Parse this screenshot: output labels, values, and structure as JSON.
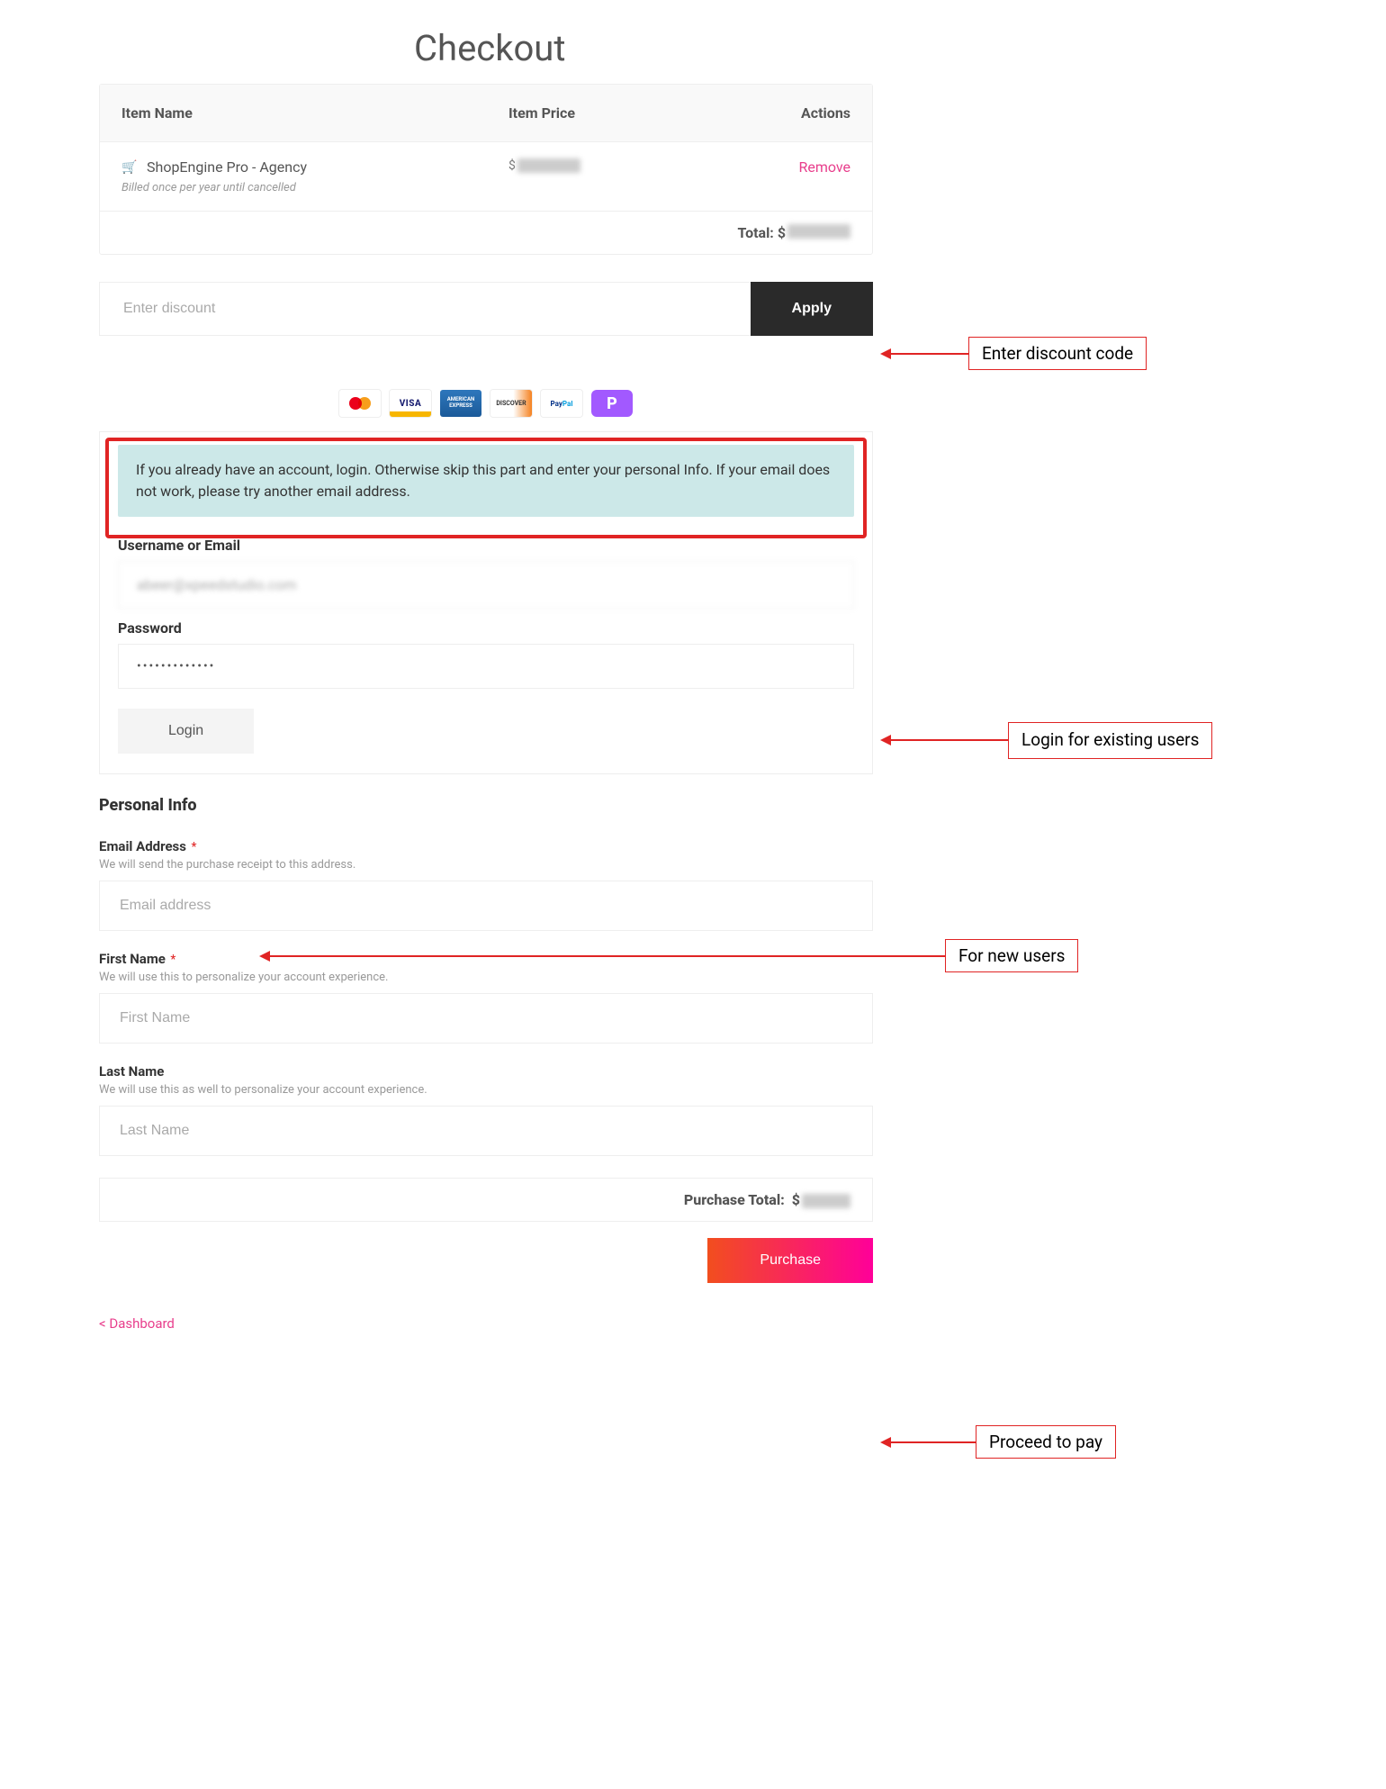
{
  "page": {
    "title": "Checkout"
  },
  "table": {
    "headers": {
      "name": "Item Name",
      "price": "Item Price",
      "actions": "Actions"
    },
    "item": {
      "name": "ShopEngine Pro - Agency",
      "subtitle": "Billed once per year until cancelled",
      "currency": "$",
      "remove": "Remove"
    },
    "total_label": "Total:",
    "total_currency": "$"
  },
  "discount": {
    "placeholder": "Enter discount",
    "apply_label": "Apply"
  },
  "login": {
    "info": "If you already have an account, login. Otherwise skip this part and enter your personal Info. If your email does not work, please try another email address.",
    "username_label": "Username or Email",
    "username_value": "abeer@xpeedstudio.com",
    "password_label": "Password",
    "password_value": "•••••••••••••",
    "login_label": "Login"
  },
  "personal": {
    "section_title": "Personal Info",
    "email": {
      "label": "Email Address",
      "required": "*",
      "help": "We will send the purchase receipt to this address.",
      "placeholder": "Email address"
    },
    "first_name": {
      "label": "First Name",
      "required": "*",
      "help": "We will use this to personalize your account experience.",
      "placeholder": "First Name"
    },
    "last_name": {
      "label": "Last Name",
      "help": "We will use this as well to personalize your account experience.",
      "placeholder": "Last Name"
    }
  },
  "purchase_total_label": "Purchase Total:",
  "purchase_total_currency": "$",
  "purchase_button": "Purchase",
  "dashboard_link": "< Dashboard",
  "annotations": {
    "discount": "Enter discount code",
    "login": "Login for existing users",
    "personal": "For new users",
    "purchase": "Proceed to pay"
  },
  "payment_icons": [
    "mastercard",
    "visa",
    "amex",
    "discover",
    "paypal",
    "paddle"
  ]
}
